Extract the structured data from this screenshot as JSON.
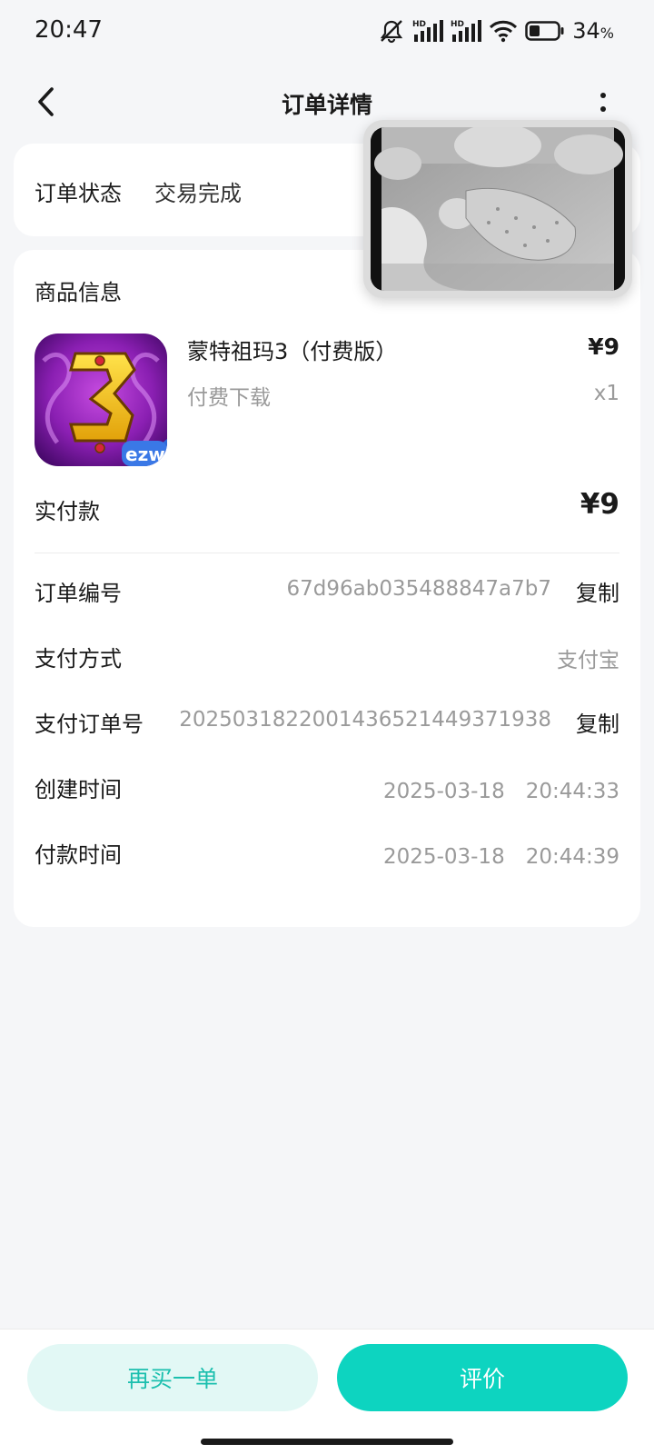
{
  "status_bar": {
    "time": "20:47",
    "battery_percent": "34",
    "battery_unit": "%",
    "icons": [
      "mute-icon",
      "hd-signal-icon",
      "hd-signal-icon",
      "wifi-icon",
      "battery-icon"
    ]
  },
  "nav": {
    "title": "订单详情",
    "back_icon": "chevron-left-icon",
    "more_icon": "more-vertical-icon"
  },
  "order_status": {
    "label": "订单状态",
    "value": "交易完成"
  },
  "goods": {
    "header": "商品信息",
    "name": "蒙特祖玛3（付费版）",
    "price": "¥9",
    "type": "付费下载",
    "quantity": "x1",
    "paid_label": "实付款",
    "paid_value": "¥9"
  },
  "details": [
    {
      "label": "订单编号",
      "value": "67d96ab035488847a7b7",
      "copy": "复制"
    },
    {
      "label": "支付方式",
      "value": "支付宝"
    },
    {
      "label": "支付订单号",
      "value": "2025031822001436521449371938",
      "copy": "复制"
    },
    {
      "label": "创建时间",
      "value": "2025-03-18　20:44:33"
    },
    {
      "label": "付款时间",
      "value": "2025-03-18　20:44:39"
    }
  ],
  "actions": {
    "rebuy": "再买一单",
    "review": "评价"
  },
  "colors": {
    "accent": "#0dd4c0",
    "accent_light": "#e2f8f5",
    "accent_text": "#1bbfae"
  }
}
